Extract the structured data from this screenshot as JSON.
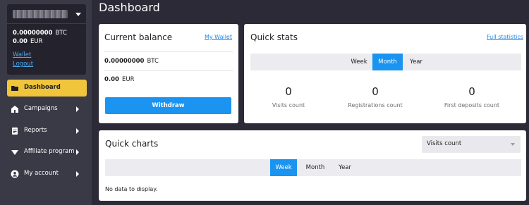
{
  "page_title": "Dashboard",
  "account": {
    "balances": [
      {
        "amount": "0.00000000",
        "currency": "BTC"
      },
      {
        "amount": "0.00",
        "currency": "EUR"
      }
    ],
    "wallet_link": "Wallet",
    "logout_link": "Logout"
  },
  "nav": {
    "items": [
      {
        "label": "Dashboard",
        "icon": "folder-icon",
        "active": true
      },
      {
        "label": "Campaigns",
        "icon": "home-icon"
      },
      {
        "label": "Reports",
        "icon": "report-icon"
      },
      {
        "label": "Affiliate program",
        "icon": "affiliate-icon"
      },
      {
        "label": "My account",
        "icon": "user-icon"
      }
    ]
  },
  "current_balance": {
    "title": "Current balance",
    "link": "My Wallet",
    "rows": [
      {
        "amount": "0.00000000",
        "currency": "BTC"
      },
      {
        "amount": "0.00",
        "currency": "EUR"
      }
    ],
    "withdraw_label": "Withdraw"
  },
  "quick_stats": {
    "title": "Quick stats",
    "link": "Full statistics",
    "tabs": [
      "Week",
      "Month",
      "Year"
    ],
    "active_tab": "Month",
    "stats": [
      {
        "value": "0",
        "label": "Visits count"
      },
      {
        "value": "0",
        "label": "Registrations count"
      },
      {
        "value": "0",
        "label": "First deposits count"
      }
    ]
  },
  "quick_charts": {
    "title": "Quick charts",
    "select_value": "Visits count",
    "tabs": [
      "Week",
      "Month",
      "Year"
    ],
    "active_tab": "Week",
    "empty_text": "No data to display."
  },
  "colors": {
    "accent": "#1a94f0",
    "nav_active": "#f0c53c",
    "background": "#2b2a36",
    "sidebar": "#3a3946"
  }
}
